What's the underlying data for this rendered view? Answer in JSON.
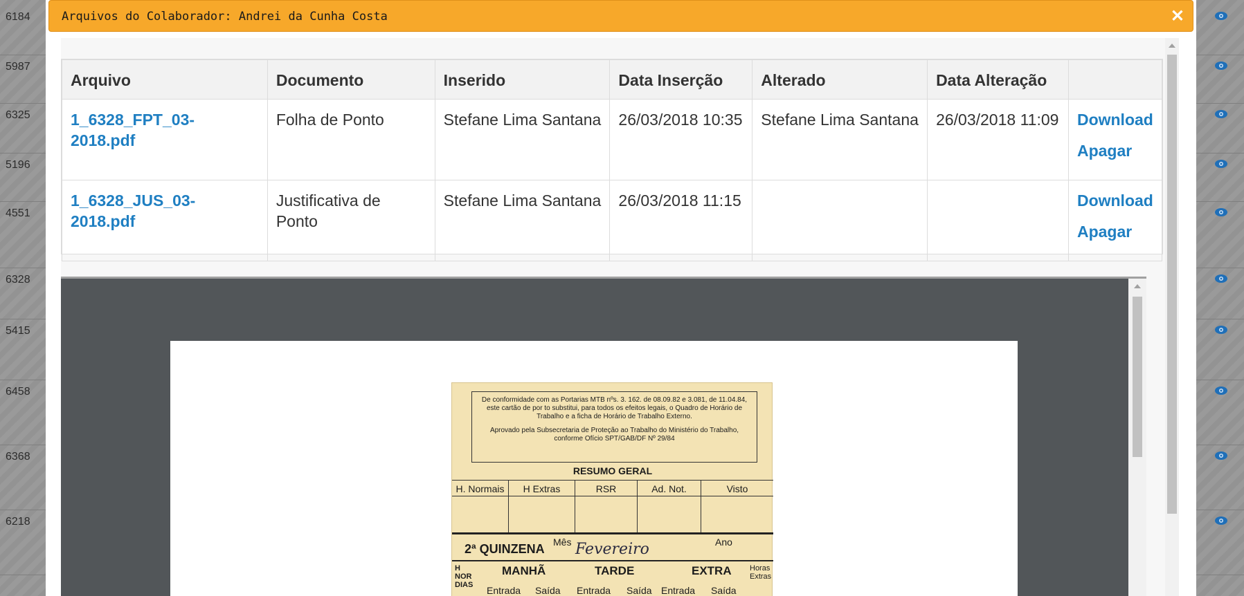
{
  "background": {
    "row_ids": [
      "6184",
      "5987",
      "6325",
      "5196",
      "4551",
      "6328",
      "5415",
      "6458",
      "6368",
      "6218"
    ],
    "row_icon": "eye-icon"
  },
  "modal": {
    "title": "Arquivos do Colaborador: Andrei da Cunha Costa",
    "close_icon": "close-icon",
    "header_color": "#f7a82a"
  },
  "table": {
    "headers": [
      "Arquivo",
      "Documento",
      "Inserido",
      "Data Inserção",
      "Alterado",
      "Data Alteração",
      ""
    ],
    "rows": [
      {
        "arquivo": "1_6328_FPT_03-2018.pdf",
        "documento": "Folha de Ponto",
        "inserido": "Stefane Lima Santana",
        "data_insercao": "26/03/2018 10:35",
        "alterado": "Stefane Lima Santana",
        "data_alteracao": "26/03/2018 11:09",
        "download": "Download",
        "apagar": "Apagar"
      },
      {
        "arquivo": "1_6328_JUS_03-2018.pdf",
        "documento": "Justificativa de Ponto",
        "inserido": "Stefane Lima Santana",
        "data_insercao": "26/03/2018 11:15",
        "alterado": "",
        "data_alteracao": "",
        "download": "Download",
        "apagar": "Apagar"
      }
    ],
    "link_color": "#1f7fc2"
  },
  "document": {
    "notice_line1": "De conformidade com as Portarias MTB nºs. 3. 162. de 08.09.82 e 3.081, de 11.04.84, este cartão de por to substitui, para todos os efeitos legais, o Quadro de Horário de Trabalho e a ficha de Horário de Trabalho Externo.",
    "notice_line2": "Aprovado pela Subsecretaria de Proteção ao Trabalho do Ministério do Trabalho, conforme Ofício SPT/GAB/DF Nº 29/84",
    "resumo_title": "RESUMO GERAL",
    "resumo_cols": [
      "H. Normais",
      "H Extras",
      "RSR",
      "Ad. Not.",
      "Visto"
    ],
    "quinzena": "2ª QUINZENA",
    "mes_label": "Mês",
    "mes_value": "Fevereiro",
    "ano_label": "Ano",
    "shifts": [
      "MANHÃ",
      "TARDE",
      "EXTRA"
    ],
    "sub_cols": [
      "Entrada",
      "Saída",
      "Entrada",
      "Saída",
      "Entrada",
      "Saída"
    ],
    "left_vertical": "H NOR DIAS",
    "right_vertical": "Horas Extras"
  }
}
